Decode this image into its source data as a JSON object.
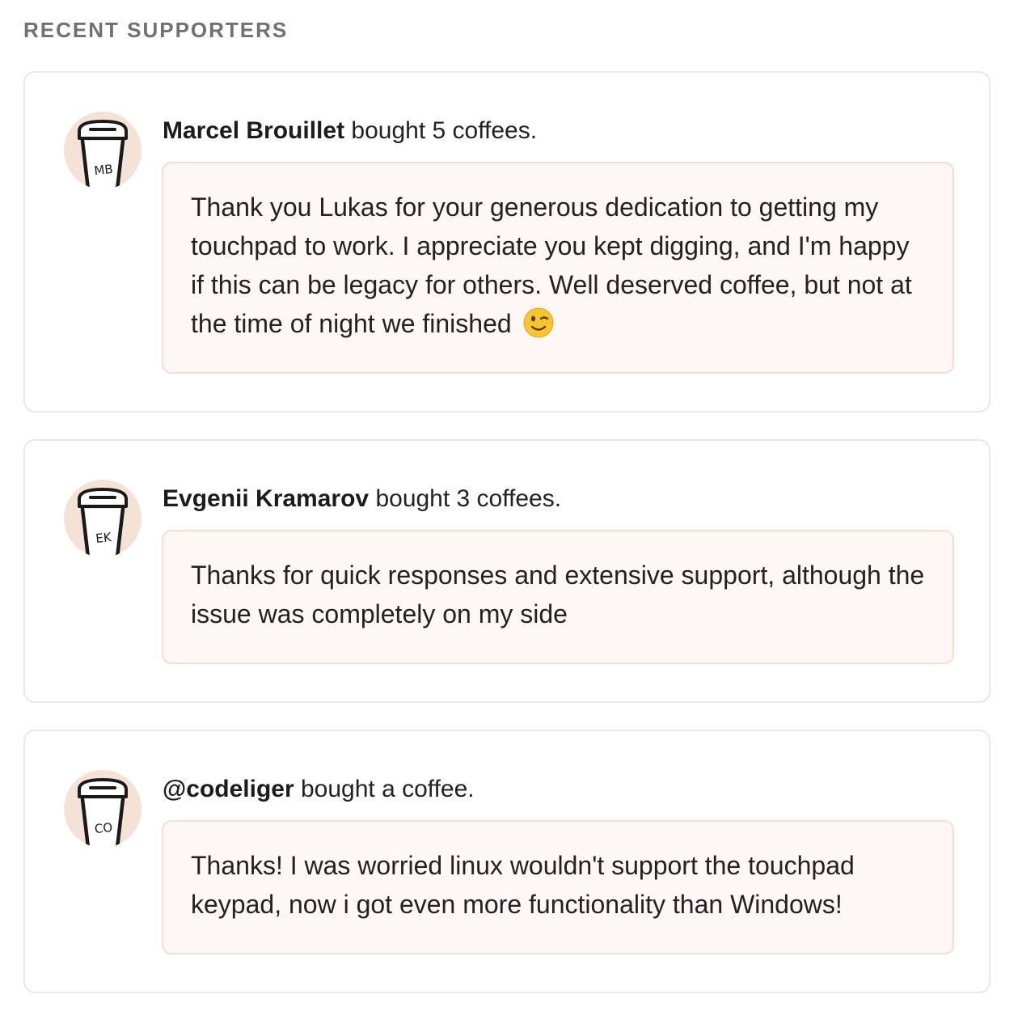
{
  "section_title": "RECENT SUPPORTERS",
  "colors": {
    "card_border": "#e9e9e9",
    "message_bg": "#fdf7f5",
    "message_border": "#f6ddd2",
    "avatar_bg": "#f5e2d7",
    "title_gray": "#717171"
  },
  "supporters": [
    {
      "name": "Marcel Brouillet",
      "action": " bought 5 coffees.",
      "initials": "MB",
      "avatar_icon": "coffee-cup-icon",
      "message": "Thank you Lukas for your generous dedication to getting my touchpad to work. I appreciate you kept digging, and I'm happy if this can be legacy for others. Well deserved coffee, but not at the time of night we finished",
      "emoji": "winking-face-icon"
    },
    {
      "name": "Evgenii Kramarov",
      "action": " bought 3 coffees.",
      "initials": "EK",
      "avatar_icon": "coffee-cup-icon",
      "message": "Thanks for quick responses and extensive support, although the issue was completely on my side"
    },
    {
      "name": "@codeliger",
      "action": " bought a coffee.",
      "initials": "CO",
      "avatar_icon": "coffee-cup-icon",
      "message": "Thanks! I was worried linux wouldn't support the touchpad keypad, now i got even more functionality than Windows!"
    }
  ]
}
